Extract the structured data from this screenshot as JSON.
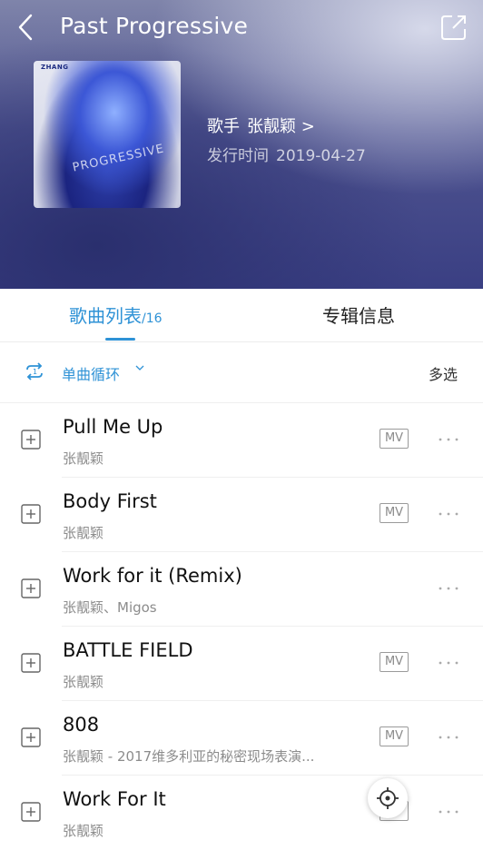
{
  "header": {
    "title": "Past Progressive",
    "artist_label": "歌手",
    "artist_name": "张靓颖",
    "artist_arrow": ">",
    "release_label": "发行时间",
    "release_date": "2019-04-27"
  },
  "cover": {
    "brand_text": "ZHANG",
    "art_text": "PROGRESSIVE"
  },
  "tabs": {
    "songs_label": "歌曲列表",
    "songs_count": "/16",
    "info_label": "专辑信息"
  },
  "controls": {
    "play_mode": "单曲循环",
    "multi_select": "多选"
  },
  "songs": [
    {
      "title": "Pull Me Up",
      "artist": "张靓颖",
      "mv": "MV"
    },
    {
      "title": "Body First",
      "artist": "张靓颖",
      "mv": "MV"
    },
    {
      "title": "Work for it (Remix)",
      "artist": "张靓颖、Migos",
      "mv": ""
    },
    {
      "title": "BATTLE FIELD",
      "artist": "张靓颖",
      "mv": "MV"
    },
    {
      "title": "808",
      "artist": "张靓颖 - 2017维多利亚的秘密现场表演...",
      "mv": "MV"
    },
    {
      "title": "Work For It",
      "artist": "张靓颖",
      "mv": "MV"
    }
  ],
  "colors": {
    "accent": "#2e92d6",
    "header_bg": "#4f5490"
  }
}
